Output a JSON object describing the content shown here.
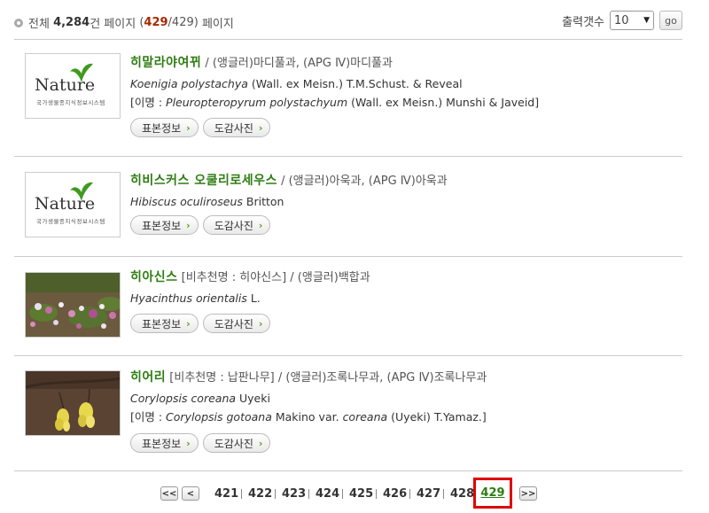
{
  "summary": {
    "total_label": "전체",
    "total_count": "4,284",
    "total_unit": "건",
    "page_label": "페이지",
    "open_paren": "(",
    "current_page": "429",
    "total_pages_suffix": "/429)",
    "page_label2": "페이지"
  },
  "perpage": {
    "label": "출력갯수",
    "value": "10",
    "go_label": "go"
  },
  "items": [
    {
      "korean_name": "히말라야여뀌",
      "family": "/ (앵글러)마디풀과, (APG Ⅳ)마디풀과",
      "sci_genus_species": "Koenigia polystachya",
      "sci_author": "(Wall. ex Meisn.) T.M.Schust. & Reveal",
      "syn_prefix": "[이명 : ",
      "syn_name": "Pleuropteropyrum polystachyum",
      "syn_author": "(Wall. ex Meisn.) Munshi & Javeid]",
      "btn1": "표본정보",
      "btn2": "도감사진",
      "thumb_word": "Nature",
      "thumb_sub": "국가생물종지식정보시스템"
    },
    {
      "korean_name": "히비스커스 오쿨리로세우스",
      "family": "/ (앵글러)아욱과, (APG Ⅳ)아욱과",
      "sci_genus_species": "Hibiscus oculiroseus",
      "sci_author": "Britton",
      "btn1": "표본정보",
      "btn2": "도감사진",
      "thumb_word": "Nature",
      "thumb_sub": "국가생물종지식정보시스템"
    },
    {
      "korean_name": "히아신스",
      "alt_name": "[비추천명 : 히야신스]",
      "family": "/ (앵글러)백합과",
      "sci_genus_species": "Hyacinthus orientalis",
      "sci_author": "L.",
      "btn1": "표본정보",
      "btn2": "도감사진"
    },
    {
      "korean_name": "히어리",
      "alt_name": "[비추천명 : 납판나무]",
      "family": "/ (앵글러)조록나무과, (APG Ⅳ)조록나무과",
      "sci_genus_species": "Corylopsis coreana",
      "sci_author": "Uyeki",
      "syn_prefix": "[이명 : ",
      "syn_name": "Corylopsis gotoana",
      "syn_mid": "Makino var.",
      "syn_epithet": "coreana",
      "syn_author": "(Uyeki) T.Yamaz.]",
      "btn1": "표본정보",
      "btn2": "도감사진"
    }
  ],
  "pagination": {
    "first": "<<",
    "prev": "<",
    "pages": [
      "421",
      "422",
      "423",
      "424",
      "425",
      "426",
      "427",
      "428"
    ],
    "current": "429",
    "next": ">>"
  },
  "colors": {
    "accent_green": "#2e7d12",
    "current_page_red": "#a52a00",
    "highlight_border": "#e00000"
  }
}
